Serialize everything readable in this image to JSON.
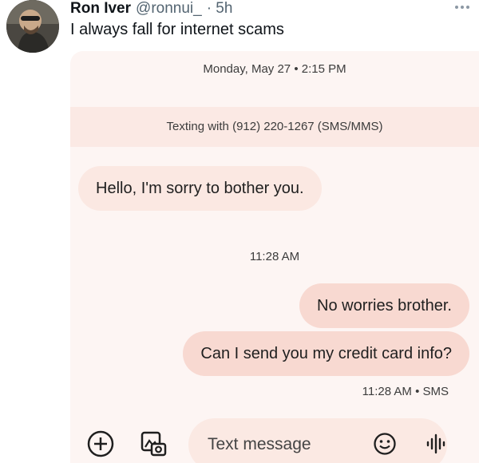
{
  "tweet": {
    "display_name": "Ron Iver",
    "handle": "@ronnui_",
    "time": "· 5h",
    "text": "I always fall for internet scams"
  },
  "conversation": {
    "date_header": "Monday, May 27 • 2:15 PM",
    "texting_with": "Texting with (912) 220-1267 (SMS/MMS)",
    "messages": [
      {
        "direction": "incoming",
        "text": "Hello, I'm sorry to bother you."
      },
      {
        "direction": "outgoing",
        "text": "No worries brother."
      },
      {
        "direction": "outgoing",
        "text": "Can I send you my credit card info?"
      }
    ],
    "mid_timestamp": "11:28 AM",
    "sent_status": "11:28 AM • SMS"
  },
  "composer": {
    "placeholder": "Text message",
    "icons": [
      "add-icon",
      "gallery-icon",
      "emoji-icon",
      "voice-icon"
    ]
  },
  "colors": {
    "background": "#fdf5f3",
    "incoming_bubble": "#fbe8e2",
    "outgoing_bubble": "#f8d9d1",
    "handle_gray": "#536471"
  }
}
